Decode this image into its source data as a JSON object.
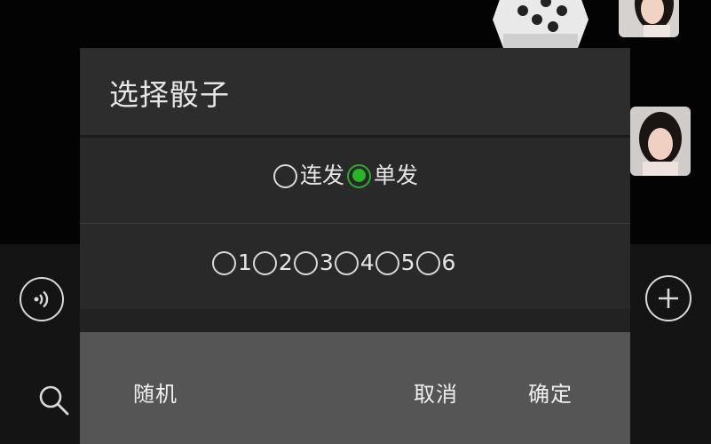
{
  "dialog": {
    "title": "选择骰子",
    "modes": [
      {
        "label": "连发",
        "checked": false
      },
      {
        "label": "单发",
        "checked": true
      }
    ],
    "numbers": [
      {
        "label": "1",
        "checked": false
      },
      {
        "label": "2",
        "checked": false
      },
      {
        "label": "3",
        "checked": false
      },
      {
        "label": "4",
        "checked": false
      },
      {
        "label": "5",
        "checked": false
      },
      {
        "label": "6",
        "checked": false
      }
    ],
    "buttons": {
      "random": "随机",
      "cancel": "取消",
      "confirm": "确定"
    }
  },
  "icons": {
    "voice": "voice-icon",
    "plus": "plus-icon",
    "search": "search-icon",
    "dice": "dice-icon"
  },
  "colors": {
    "accent": "#29b429",
    "dialog_bg": "#2b2b2b",
    "button_bar_bg": "#555555",
    "text": "#e6e6e6"
  }
}
